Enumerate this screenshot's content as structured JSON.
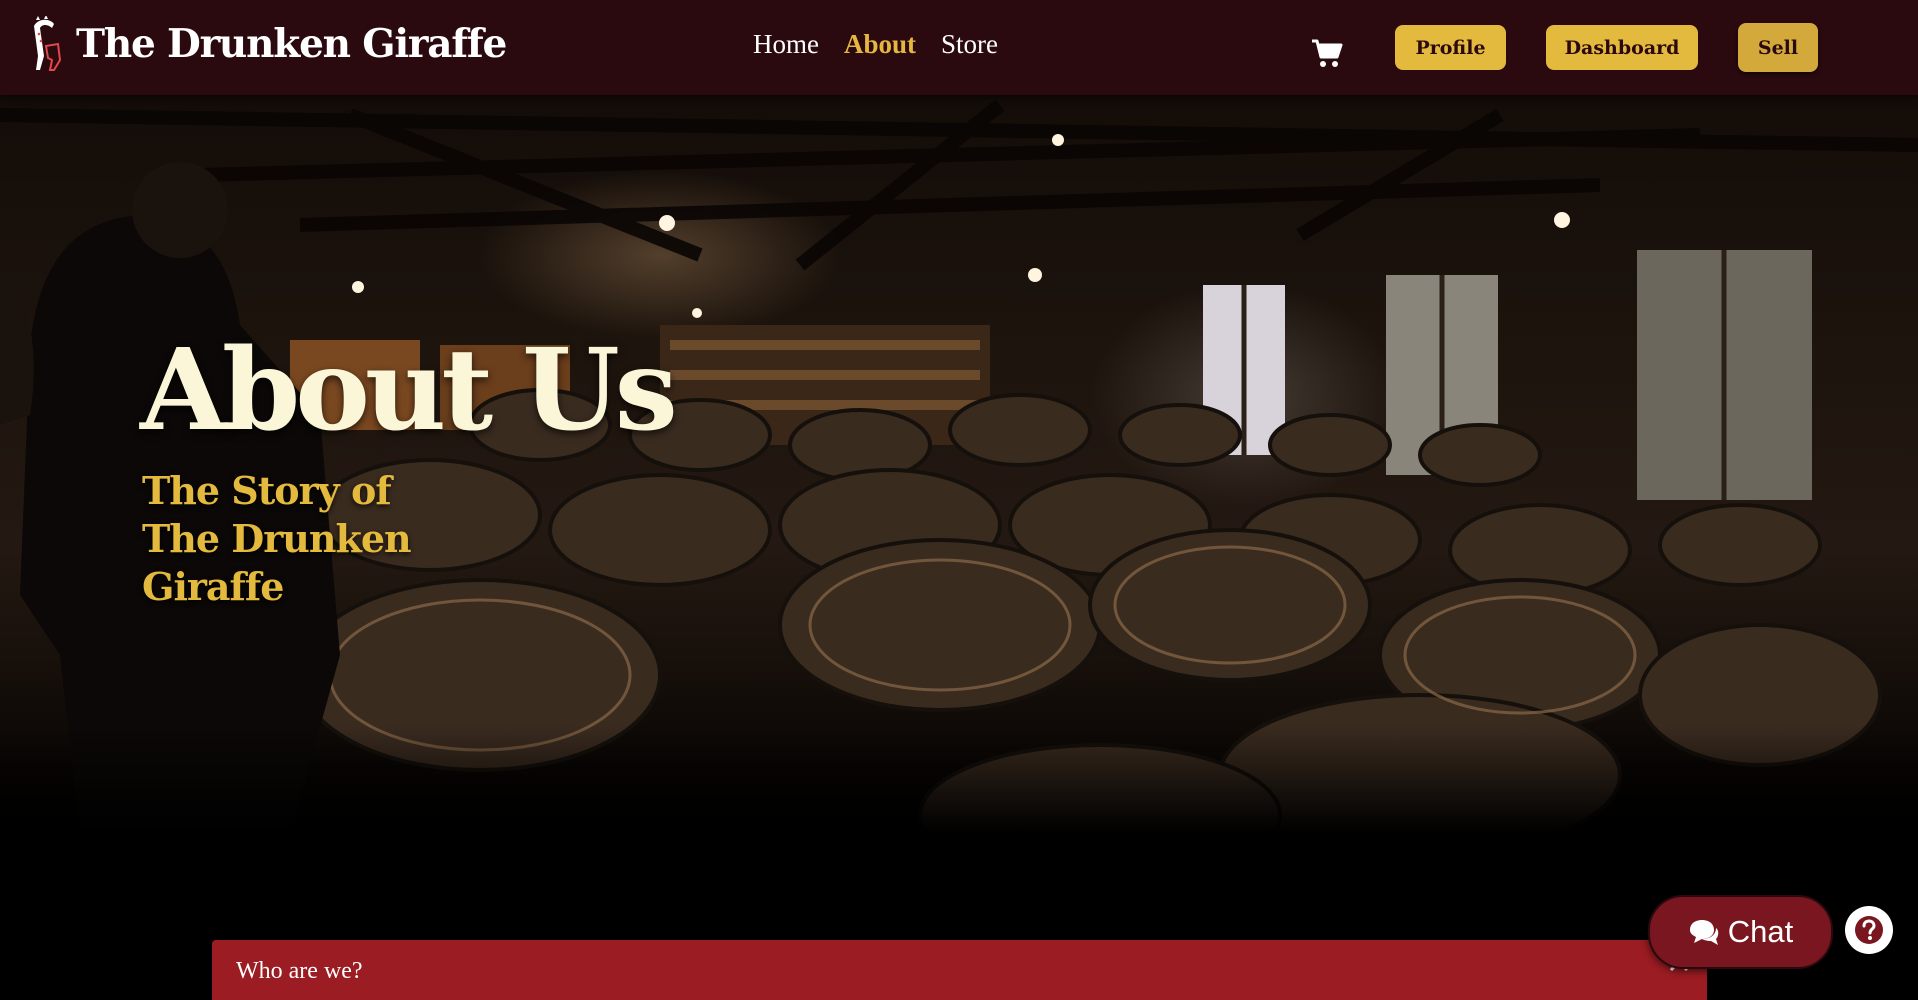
{
  "navbar": {
    "brand_name": "The Drunken Giraffe",
    "logo_icon": "giraffe-logo",
    "links": [
      {
        "label": "Home",
        "active": false
      },
      {
        "label": "About",
        "active": true
      },
      {
        "label": "Store",
        "active": false
      }
    ],
    "cart_icon": "shopping-cart-icon",
    "buttons": {
      "profile": "Profile",
      "dashboard": "Dashboard",
      "sell": "Sell"
    }
  },
  "hero": {
    "title": "About Us",
    "subtitle": "The Story of The Drunken Giraffe",
    "background": "wine-cellar-barrels-photo"
  },
  "accordion": {
    "title": "Who are we?",
    "icon": "chevron-up-icon"
  },
  "floating": {
    "chat_label": "Chat",
    "chat_icon": "chat-bubbles-icon",
    "help_icon": "question-circle-icon"
  },
  "colors": {
    "navbar_bg": "#2a0a0e",
    "accent_gold": "#e3b93e",
    "active_link": "#e5b640",
    "accordion_bg": "#9b1c22",
    "chat_bg": "#7a1620",
    "hero_title": "#fbf6d8"
  }
}
